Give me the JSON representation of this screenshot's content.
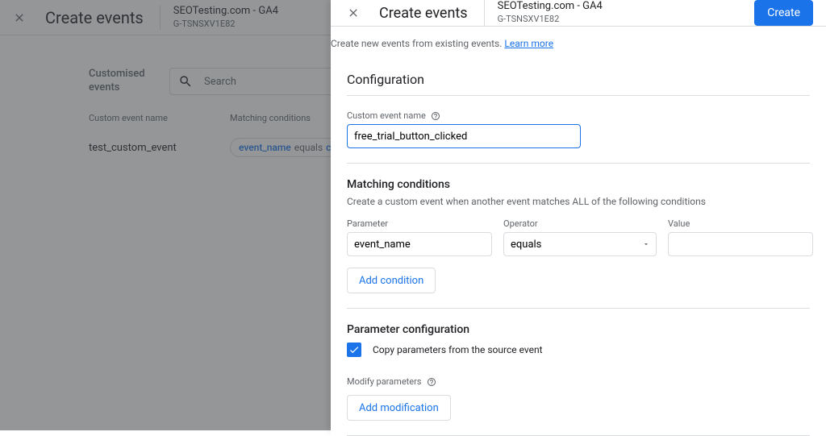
{
  "background": {
    "title": "Create events",
    "property_name": "SEOTesting.com - GA4",
    "property_id": "G-TSNSXV1E82",
    "customised_events_label": "Customised events",
    "search_placeholder": "Search",
    "columns": {
      "name": "Custom event name",
      "conditions": "Matching conditions"
    },
    "rows": [
      {
        "name": "test_custom_event",
        "param": "event_name",
        "operator": "equals",
        "value_prefix": "cl"
      }
    ]
  },
  "panel": {
    "header": {
      "title": "Create events",
      "property_name": "SEOTesting.com - GA4",
      "property_id": "G-TSNSXV1E82",
      "create_button": "Create"
    },
    "intro_text": "Create new events from existing events.",
    "learn_more": "Learn more",
    "configuration": {
      "heading": "Configuration",
      "name_label": "Custom event name",
      "name_value": "free_trial_button_clicked"
    },
    "matching": {
      "heading": "Matching conditions",
      "description": "Create a custom event when another event matches ALL of the following conditions",
      "col_parameter": "Parameter",
      "col_operator": "Operator",
      "col_value": "Value",
      "conditions": [
        {
          "parameter": "event_name",
          "operator": "equals",
          "value": ""
        }
      ],
      "add_condition": "Add condition"
    },
    "param_config": {
      "heading": "Parameter configuration",
      "copy_checkbox_checked": true,
      "copy_label": "Copy parameters from the source event",
      "modify_label": "Modify parameters",
      "add_modification": "Add modification"
    }
  }
}
